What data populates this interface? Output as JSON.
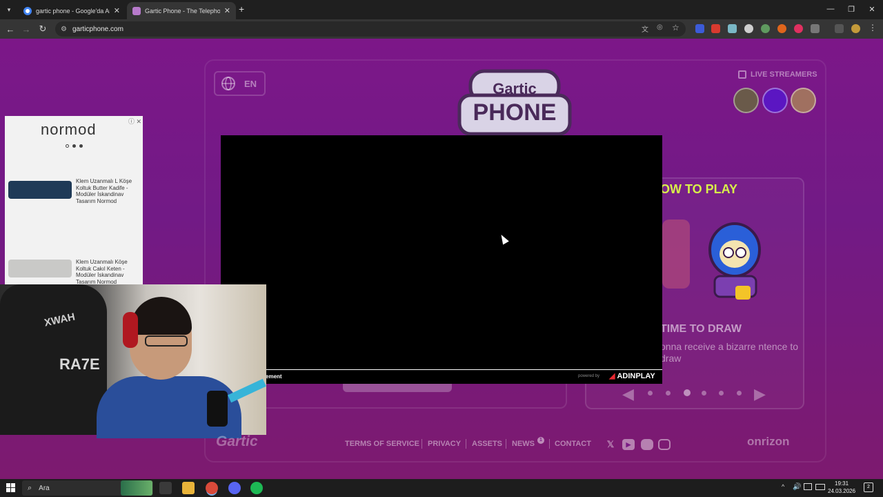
{
  "browser": {
    "tabs": [
      {
        "title": "gartic phone - Google'da Ara",
        "close": "✕"
      },
      {
        "title": "Gartic Phone - The Telephone G",
        "close": "✕"
      }
    ],
    "new_tab": "+",
    "url": "garticphone.com",
    "window_controls": {
      "minimize": "—",
      "restore": "❐",
      "close": "✕"
    }
  },
  "page": {
    "language": "EN",
    "logo_top": "Gartic",
    "logo_bottom": "PHONE",
    "live_streamers_label": "LIVE STREAMERS",
    "how_to_play": {
      "title": "OW TO PLAY",
      "step_title": "TIME TO DRAW",
      "step_desc": "onna receive a bizarre ntence to draw",
      "active_dot": 2
    },
    "footer": {
      "logo": "Gartic",
      "links": [
        "TERMS OF SERVICE",
        "PRIVACY",
        "ASSETS",
        "NEWS",
        "CONTACT"
      ],
      "news_badge": "1",
      "social_icons": [
        "x-icon",
        "youtube-icon",
        "discord-icon",
        "instagram-icon"
      ],
      "brand": "onrizon"
    }
  },
  "ad_overlay": {
    "label": "ement",
    "powered_by": "powered by",
    "brand": "ADINPLAY"
  },
  "side_ad": {
    "brand": "normod",
    "items": [
      {
        "text": "Klem Uzanmalı L Köşe Koltuk Butter Kadife - Modüler İskandinav Tasarım Normod",
        "color": "#1f3a57"
      },
      {
        "text": "Klem Uzanmalı Köşe Koltuk Cakıl Keten - Modüler İskandinav Tasarım Normod",
        "color": "#c9c9c7"
      }
    ]
  },
  "webcam": {
    "chair_text_1": "XWAH",
    "chair_text_2": "RA7E"
  },
  "taskbar": {
    "search_placeholder": "Ara",
    "time": "19:31",
    "date": "24.03.2026",
    "notification_count": "2"
  },
  "colors": {
    "page_bg": "#7a1a85",
    "howto_title": "#d8f04a",
    "adinplay_red": "#e8272f"
  }
}
